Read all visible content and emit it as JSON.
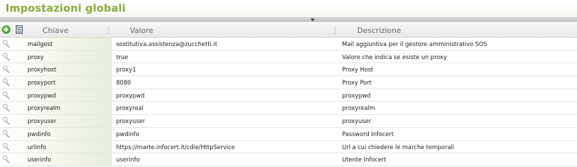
{
  "panel": {
    "title": "Impostazioni globali"
  },
  "toolbar": {
    "add_icon": "add-icon",
    "export_icon": "export-icon"
  },
  "grid": {
    "columns": [
      "Chiave",
      "Valore",
      "Descrizione"
    ],
    "rows": [
      {
        "key": "mailgest",
        "value": "sostitutiva.assistenza@zucchetti.it",
        "description": "Mail aggiuntiva per il gestore amministrativo SOS"
      },
      {
        "key": "proxy",
        "value": "true",
        "description": "Valore che indica se esiste un proxy"
      },
      {
        "key": "proxyhost",
        "value": "proxy1",
        "description": "Proxy Host"
      },
      {
        "key": "proxyport",
        "value": "8080",
        "description": "Proxy Port"
      },
      {
        "key": "proxypwd",
        "value": "proxypwd",
        "description": "proxypwd"
      },
      {
        "key": "proxyrealm",
        "value": "proxyreal",
        "description": "proxyrealm"
      },
      {
        "key": "proxyuser",
        "value": "proxyuser",
        "description": "proxyuser"
      },
      {
        "key": "pwdinfo",
        "value": "pwdinfo",
        "description": "Password Infocert"
      },
      {
        "key": "urlinfo",
        "value": "https://marte.infocert.it/cdie/HttpService",
        "description": "Url a cui chiedere le marche temporali"
      },
      {
        "key": "userinfo",
        "value": "userinfo",
        "description": "Utente Infocert"
      }
    ]
  },
  "colors": {
    "title": "#8aaa3c",
    "key_cell": "#e7eedb"
  }
}
